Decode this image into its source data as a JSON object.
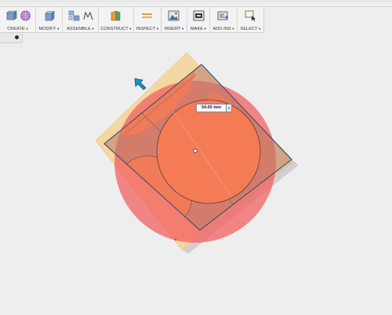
{
  "toolbar": {
    "create": "CREATE",
    "modify": "MODIFY",
    "assemble": "ASSEMBLE",
    "construct": "CONSTRUCT",
    "inspect": "INSPECT",
    "insert": "INSERT",
    "make": "MAKE",
    "addins": "ADD-INS",
    "select": "SELECT",
    "caret": "▾"
  },
  "dimension": {
    "value": "54.00 mm",
    "dropdown": "▾"
  },
  "colors": {
    "sphere": "#f25c5c",
    "cut_face": "#f57b55",
    "plane": "#f5cf8a",
    "cube_edge": "#3f4f66",
    "manipulator_arrow": "#1c8fc9"
  }
}
